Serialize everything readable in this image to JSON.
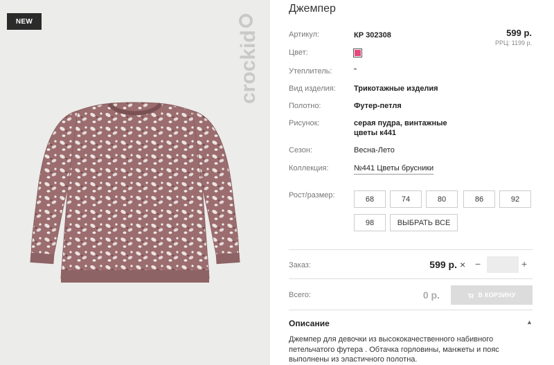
{
  "badge": "NEW",
  "brand": "crockid",
  "product": {
    "title": "Джемпер",
    "article_label": "Артикул:",
    "article_value": "КР 302308",
    "price": "599 р.",
    "rrp": "РРЦ: 1199 р.",
    "color_label": "Цвет:",
    "color_hex": "#e8477e",
    "insulation_label": "Утеплитель:",
    "insulation_value": "\"",
    "type_label": "Вид изделия:",
    "type_value": "Трикотажные изделия",
    "fabric_label": "Полотно:",
    "fabric_value": "Футер-петля",
    "pattern_label": "Рисунок:",
    "pattern_value_line1": "серая пудра, винтажные",
    "pattern_value_line2": "цветы к441",
    "season_label": "Сезон:",
    "season_value": "Весна-Лето",
    "collection_label": "Коллекция:",
    "collection_value": "№441 Цветы брусники"
  },
  "sizes": {
    "label": "Рост/размер:",
    "options": [
      "68",
      "74",
      "80",
      "86",
      "92",
      "98"
    ],
    "select_all": "ВЫБРАТЬ ВСЕ"
  },
  "order": {
    "label": "Заказ:",
    "price": "599 р.",
    "times": "×",
    "minus": "−",
    "quantity": "",
    "plus": "+"
  },
  "total": {
    "label": "Всего:",
    "value": "0 р.",
    "cart_button": "В КОРЗИНУ"
  },
  "description": {
    "title": "Описание",
    "text": "Джемпер для девочки из высококачественного набивного петельчатого футера . Обтачка горловины, манжеты и пояс выполнены из эластичного полотна."
  }
}
